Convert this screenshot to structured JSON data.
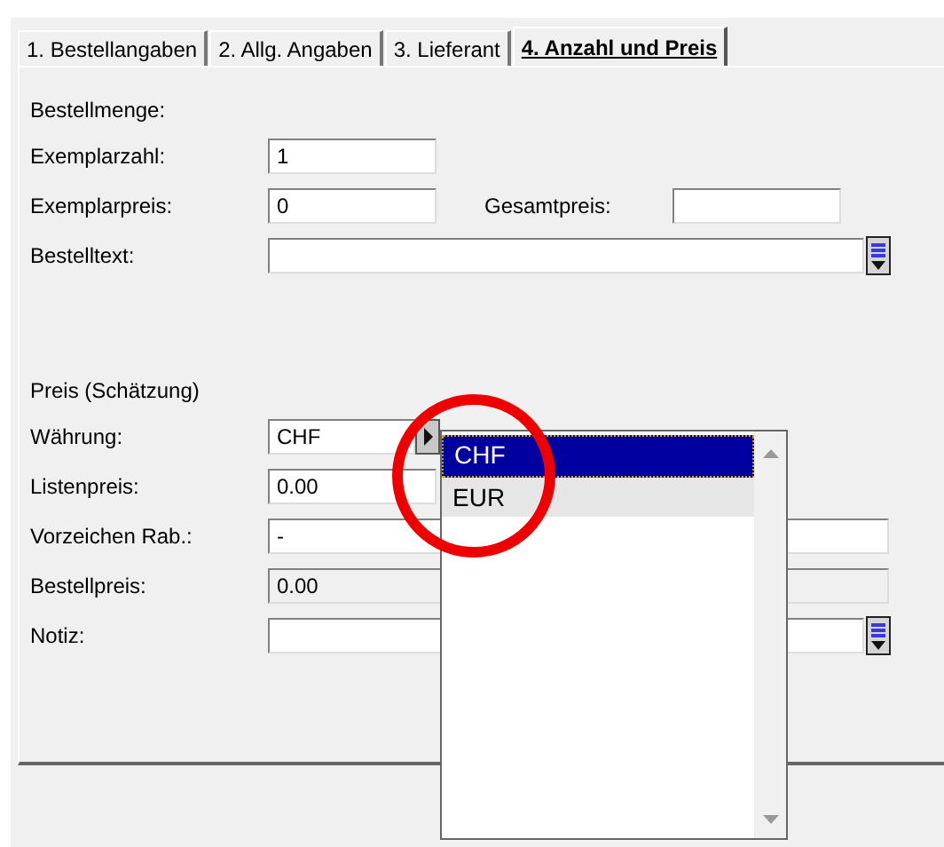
{
  "tabs": [
    {
      "label": "1. Bestellangaben",
      "selected": false
    },
    {
      "label": "2. Allg. Angaben",
      "selected": false
    },
    {
      "label": "3. Lieferant",
      "selected": false
    },
    {
      "label": "4. Anzahl und Preis",
      "selected": true
    }
  ],
  "sections": [
    {
      "heading": "Bestellmenge:",
      "rows": [
        {
          "kind": "short",
          "label": "Exemplarzahl:",
          "value": "1"
        },
        {
          "kind": "pair",
          "label": "Exemplarpreis:",
          "value": "0",
          "side_label": "Gesamtpreis:"
        },
        {
          "kind": "memo",
          "label": "Bestelltext:"
        }
      ]
    },
    {
      "heading": "Preis (Schätzung)",
      "rows": [
        {
          "kind": "combo",
          "label": "Währung:",
          "value": "CHF"
        },
        {
          "kind": "short",
          "label": "Listenpreis:",
          "value": "0.00"
        },
        {
          "kind": "wide",
          "label": "Vorzeichen Rab.:",
          "value": "-",
          "disabled": false
        },
        {
          "kind": "wide",
          "label": "Bestellpreis:",
          "value": "0.00",
          "disabled": true
        },
        {
          "kind": "memo",
          "label": "Notiz:"
        }
      ]
    }
  ],
  "dropdown": {
    "options": [
      {
        "label": "CHF",
        "selected": true,
        "hovered": false
      },
      {
        "label": "EUR",
        "selected": false,
        "hovered": true
      }
    ]
  },
  "annotation": {
    "kind": "circle"
  }
}
